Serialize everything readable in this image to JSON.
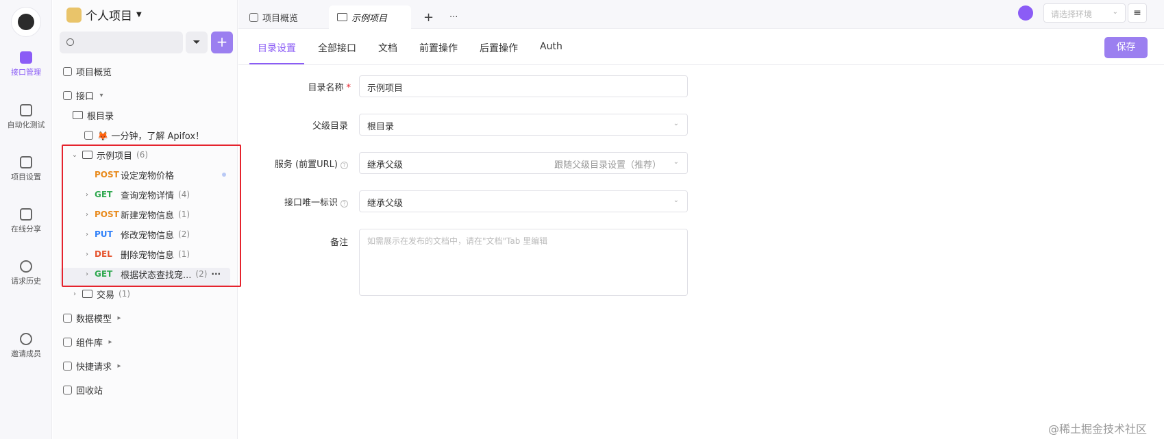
{
  "rail": {
    "items": [
      {
        "label": "接口管理",
        "active": true
      },
      {
        "label": "自动化测试"
      },
      {
        "label": "项目设置"
      },
      {
        "label": "在线分享"
      },
      {
        "label": "请求历史"
      },
      {
        "label": "邀请成员"
      }
    ]
  },
  "sidebar": {
    "project_name": "个人项目",
    "search_placeholder": "",
    "overview": "项目概览",
    "interfaces": "接口",
    "root": "根目录",
    "intro_doc": "🦊 一分钟，了解 Apifox！",
    "folder": {
      "name": "示例项目",
      "count": "(6)"
    },
    "endpoints": [
      {
        "method": "POST",
        "name": "设定宠物价格",
        "count": ""
      },
      {
        "method": "GET",
        "name": "查询宠物详情",
        "count": "(4)"
      },
      {
        "method": "POST",
        "name": "新建宠物信息",
        "count": "(1)"
      },
      {
        "method": "PUT",
        "name": "修改宠物信息",
        "count": "(2)"
      },
      {
        "method": "DEL",
        "name": "删除宠物信息",
        "count": "(1)"
      },
      {
        "method": "GET",
        "name": "根据状态查找宠...",
        "count": "(2)"
      }
    ],
    "trade": {
      "name": "交易",
      "count": "(1)"
    },
    "data_model": "数据模型",
    "components": "组件库",
    "quick_request": "快捷请求",
    "recycle": "回收站",
    "more": "···"
  },
  "topbar": {
    "tabs": [
      {
        "label": "项目概览"
      },
      {
        "label": "示例项目",
        "active": true
      }
    ],
    "add": "+",
    "more": "···",
    "env_placeholder": "请选择环境",
    "menu": "≡"
  },
  "subtabs": [
    "目录设置",
    "全部接口",
    "文档",
    "前置操作",
    "后置操作",
    "Auth"
  ],
  "save_label": "保存",
  "form": {
    "name_label": "目录名称",
    "name_value": "示例项目",
    "parent_label": "父级目录",
    "parent_value": "根目录",
    "service_label": "服务 (前置URL)",
    "service_value": "继承父级",
    "service_hint": "跟随父级目录设置（推荐）",
    "uid_label": "接口唯一标识",
    "uid_value": "继承父级",
    "note_label": "备注",
    "note_placeholder": "如需展示在发布的文档中，请在\"文档\"Tab 里编辑"
  },
  "watermark": "@稀土掘金技术社区",
  "colors": {
    "accent": "#8b5cf6",
    "highlight_box": "#e5232d"
  }
}
